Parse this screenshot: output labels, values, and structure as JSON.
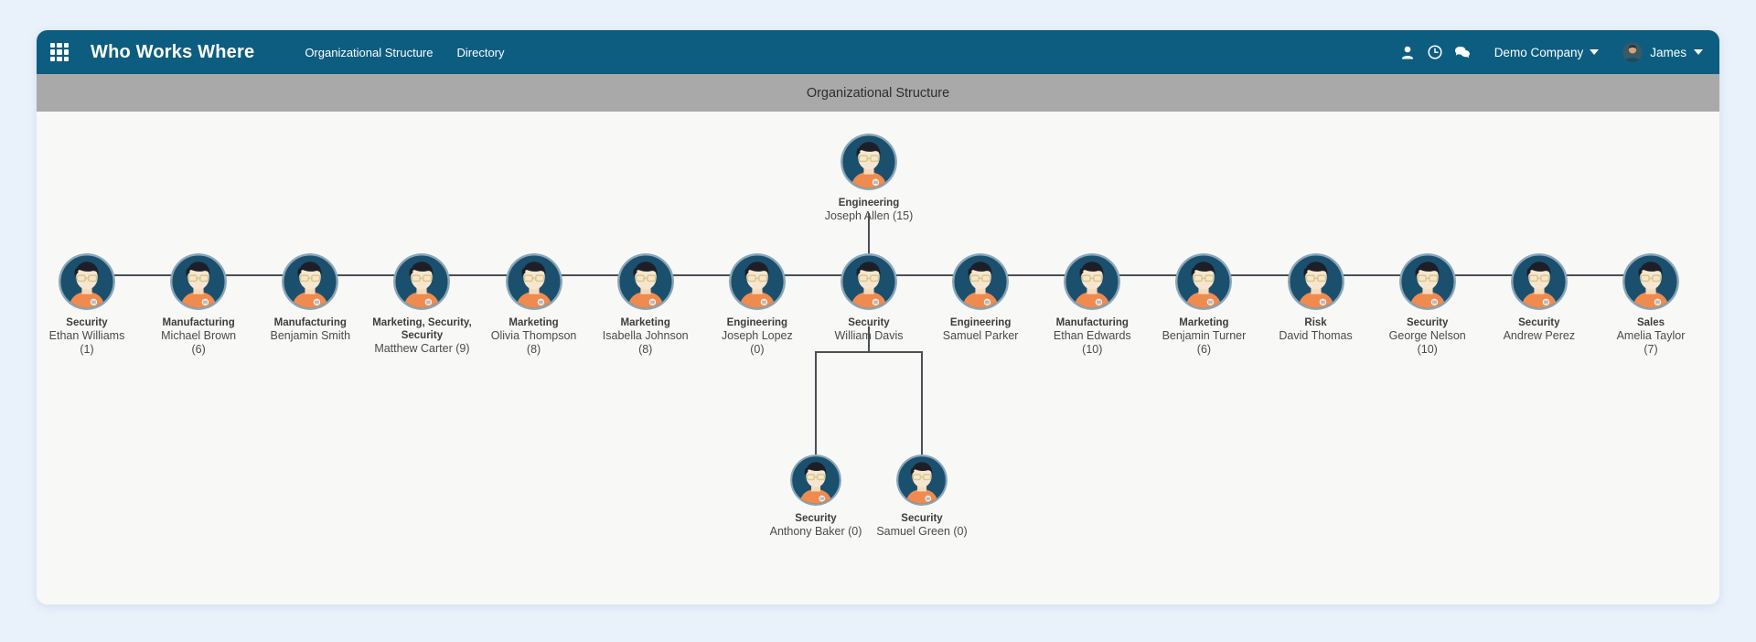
{
  "topbar": {
    "grid_icon": "grid-apps-icon",
    "brand": "Who Works Where",
    "nav": [
      {
        "label": "Organizational Structure",
        "name": "nav-organizational-structure"
      },
      {
        "label": "Directory",
        "name": "nav-directory"
      }
    ],
    "icons": [
      {
        "name": "user-icon",
        "glyph": "A"
      },
      {
        "name": "clock-icon",
        "glyph": "B"
      },
      {
        "name": "chat-icon",
        "glyph": "C"
      }
    ],
    "company": "Demo Company",
    "user": "James",
    "accent_color": "#0d5d80"
  },
  "subheader": {
    "title": "Organizational Structure",
    "bg_color": "#a9a9a9"
  },
  "chart_data": {
    "type": "tree",
    "title": "Organizational Structure",
    "root": {
      "id": "joseph-allen",
      "department": "Engineering",
      "person": "Joseph Allen (15)",
      "name_only": "Joseph Allen",
      "count": 15
    },
    "level1": [
      {
        "id": "ethan-williams",
        "department": "Security",
        "person": "Ethan Williams",
        "count": 1,
        "label": "(1)"
      },
      {
        "id": "michael-brown",
        "department": "Manufacturing",
        "person": "Michael Brown",
        "count": 6,
        "label": "(6)"
      },
      {
        "id": "benjamin-smith",
        "department": "Manufacturing",
        "person": "Benjamin Smith",
        "count": null,
        "label": ""
      },
      {
        "id": "matthew-carter",
        "department": "Marketing, Security, Security",
        "person": "Matthew Carter (9)",
        "count": 9,
        "label": ""
      },
      {
        "id": "olivia-thompson",
        "department": "Marketing",
        "person": "Olivia Thompson",
        "count": 8,
        "label": "(8)"
      },
      {
        "id": "isabella-johnson",
        "department": "Marketing",
        "person": "Isabella Johnson",
        "count": 8,
        "label": "(8)"
      },
      {
        "id": "joseph-lopez",
        "department": "Engineering",
        "person": "Joseph Lopez",
        "count": 0,
        "label": "(0)"
      },
      {
        "id": "william-davis",
        "department": "Security",
        "person": "William Davis",
        "count": null,
        "label": ""
      },
      {
        "id": "samuel-parker",
        "department": "Engineering",
        "person": "Samuel Parker",
        "count": null,
        "label": ""
      },
      {
        "id": "ethan-edwards",
        "department": "Manufacturing",
        "person": "Ethan Edwards",
        "count": 10,
        "label": "(10)"
      },
      {
        "id": "benjamin-turner",
        "department": "Marketing",
        "person": "Benjamin Turner",
        "count": 6,
        "label": "(6)"
      },
      {
        "id": "david-thomas",
        "department": "Risk",
        "person": "David Thomas",
        "count": null,
        "label": ""
      },
      {
        "id": "george-nelson",
        "department": "Security",
        "person": "George Nelson",
        "count": 10,
        "label": "(10)"
      },
      {
        "id": "andrew-perez",
        "department": "Security",
        "person": "Andrew Perez",
        "count": null,
        "label": ""
      },
      {
        "id": "amelia-taylor",
        "department": "Sales",
        "person": "Amelia Taylor",
        "count": 7,
        "label": "(7)"
      }
    ],
    "level2": {
      "parent": "william-davis",
      "nodes": [
        {
          "id": "anthony-baker",
          "department": "Security",
          "person": "Anthony Baker (0)",
          "count": 0
        },
        {
          "id": "samuel-green",
          "department": "Security",
          "person": "Samuel Green (0)",
          "count": 0
        }
      ]
    },
    "line_color": "#4a4f54",
    "avatar_ring_color": "#1f4f73",
    "avatar_bg_color": "#1b4f6e"
  }
}
